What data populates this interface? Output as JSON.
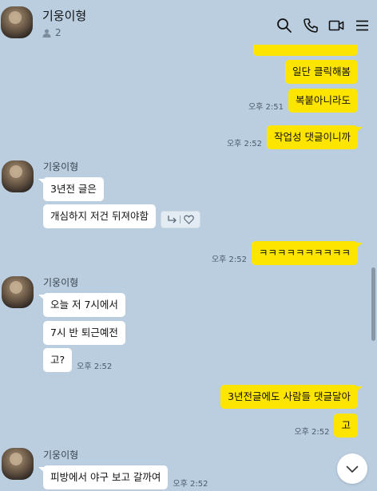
{
  "header": {
    "title": "기웅이형",
    "member_count": "2"
  },
  "messages": {
    "m1": {
      "text": "일단 클릭해봄"
    },
    "m2": {
      "text": "복붙아니라도",
      "time": "오후 2:51"
    },
    "m3": {
      "text": "작업성 댓글이니까",
      "time": "오후 2:52"
    },
    "g1": {
      "sender": "기웅이형",
      "lines": [
        "3년전 글은",
        "개심하지 저건 뒤져야함"
      ]
    },
    "m4": {
      "text": "ㅋㅋㅋㅋㅋㅋㅋㅋㅋㅋ",
      "time": "오후 2:52"
    },
    "g2": {
      "sender": "기웅이형",
      "lines": [
        "오늘 저 7시에서",
        "7시 반 퇴근예전",
        "고?"
      ],
      "time": "오후 2:52"
    },
    "m5": {
      "text": "3년전글에도 사람들 댓글달아"
    },
    "m6": {
      "text": "고",
      "time": "오후 2:52"
    },
    "g3": {
      "sender": "기웅이형",
      "lines": [
        "피방에서 야구 보고 갈까여"
      ],
      "time": "오후 2:52"
    }
  },
  "colors": {
    "background": "#bacee0",
    "my_bubble": "#fee500",
    "their_bubble": "#ffffff"
  },
  "icons": [
    "search-icon",
    "phone-icon",
    "video-call-icon",
    "menu-icon",
    "person-icon",
    "reply-icon",
    "heart-icon",
    "chevron-down-icon"
  ]
}
